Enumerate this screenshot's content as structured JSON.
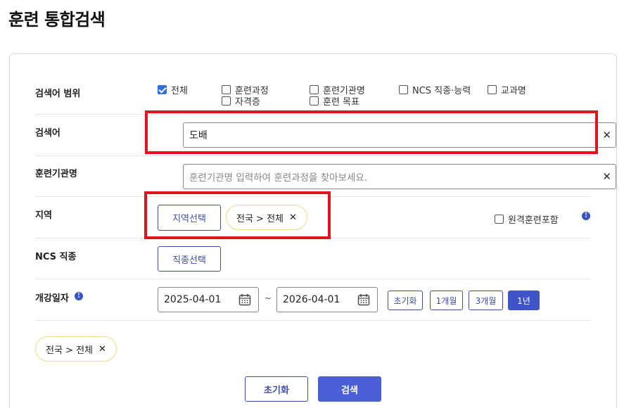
{
  "title": "훈련 통합검색",
  "scope": {
    "label": "검색어 범위",
    "options": [
      {
        "label": "전체",
        "checked": true
      },
      {
        "label": "훈련과정",
        "checked": false
      },
      {
        "label": "훈련기관명",
        "checked": false
      },
      {
        "label": "NCS 직종·능력",
        "checked": false
      },
      {
        "label": "교과명",
        "checked": false
      },
      {
        "label": "자격증",
        "checked": false
      },
      {
        "label": "훈련 목표",
        "checked": false
      }
    ]
  },
  "keyword": {
    "label": "검색어",
    "value": "도배",
    "clear": "✕"
  },
  "institution": {
    "label": "훈련기관명",
    "placeholder": "훈련기관명 입력하여 훈련과정을 찾아보세요.",
    "clear": "✕"
  },
  "region": {
    "label": "지역",
    "select_button": "지역선택",
    "chip": "전국 > 전체",
    "remote_label": "원격훈련포함",
    "remote_checked": false
  },
  "ncs": {
    "label": "NCS 직종",
    "select_button": "직종선택"
  },
  "open_date": {
    "label": "개강일자",
    "start": "2025-04-01",
    "separator": "~",
    "end": "2026-04-01",
    "periods": [
      {
        "label": "초기화",
        "active": false
      },
      {
        "label": "1개월",
        "active": false
      },
      {
        "label": "3개월",
        "active": false
      },
      {
        "label": "1년",
        "active": true
      }
    ]
  },
  "selected_chip": "전국 > 전체",
  "chip_close": "✕",
  "info_glyph": "!",
  "buttons": {
    "reset": "초기화",
    "search": "검색"
  },
  "colors": {
    "accent": "#3e4fa8",
    "primary_button": "#4a5fd6",
    "highlight": "#e0141e",
    "chip_border": "#e8dc8a"
  }
}
